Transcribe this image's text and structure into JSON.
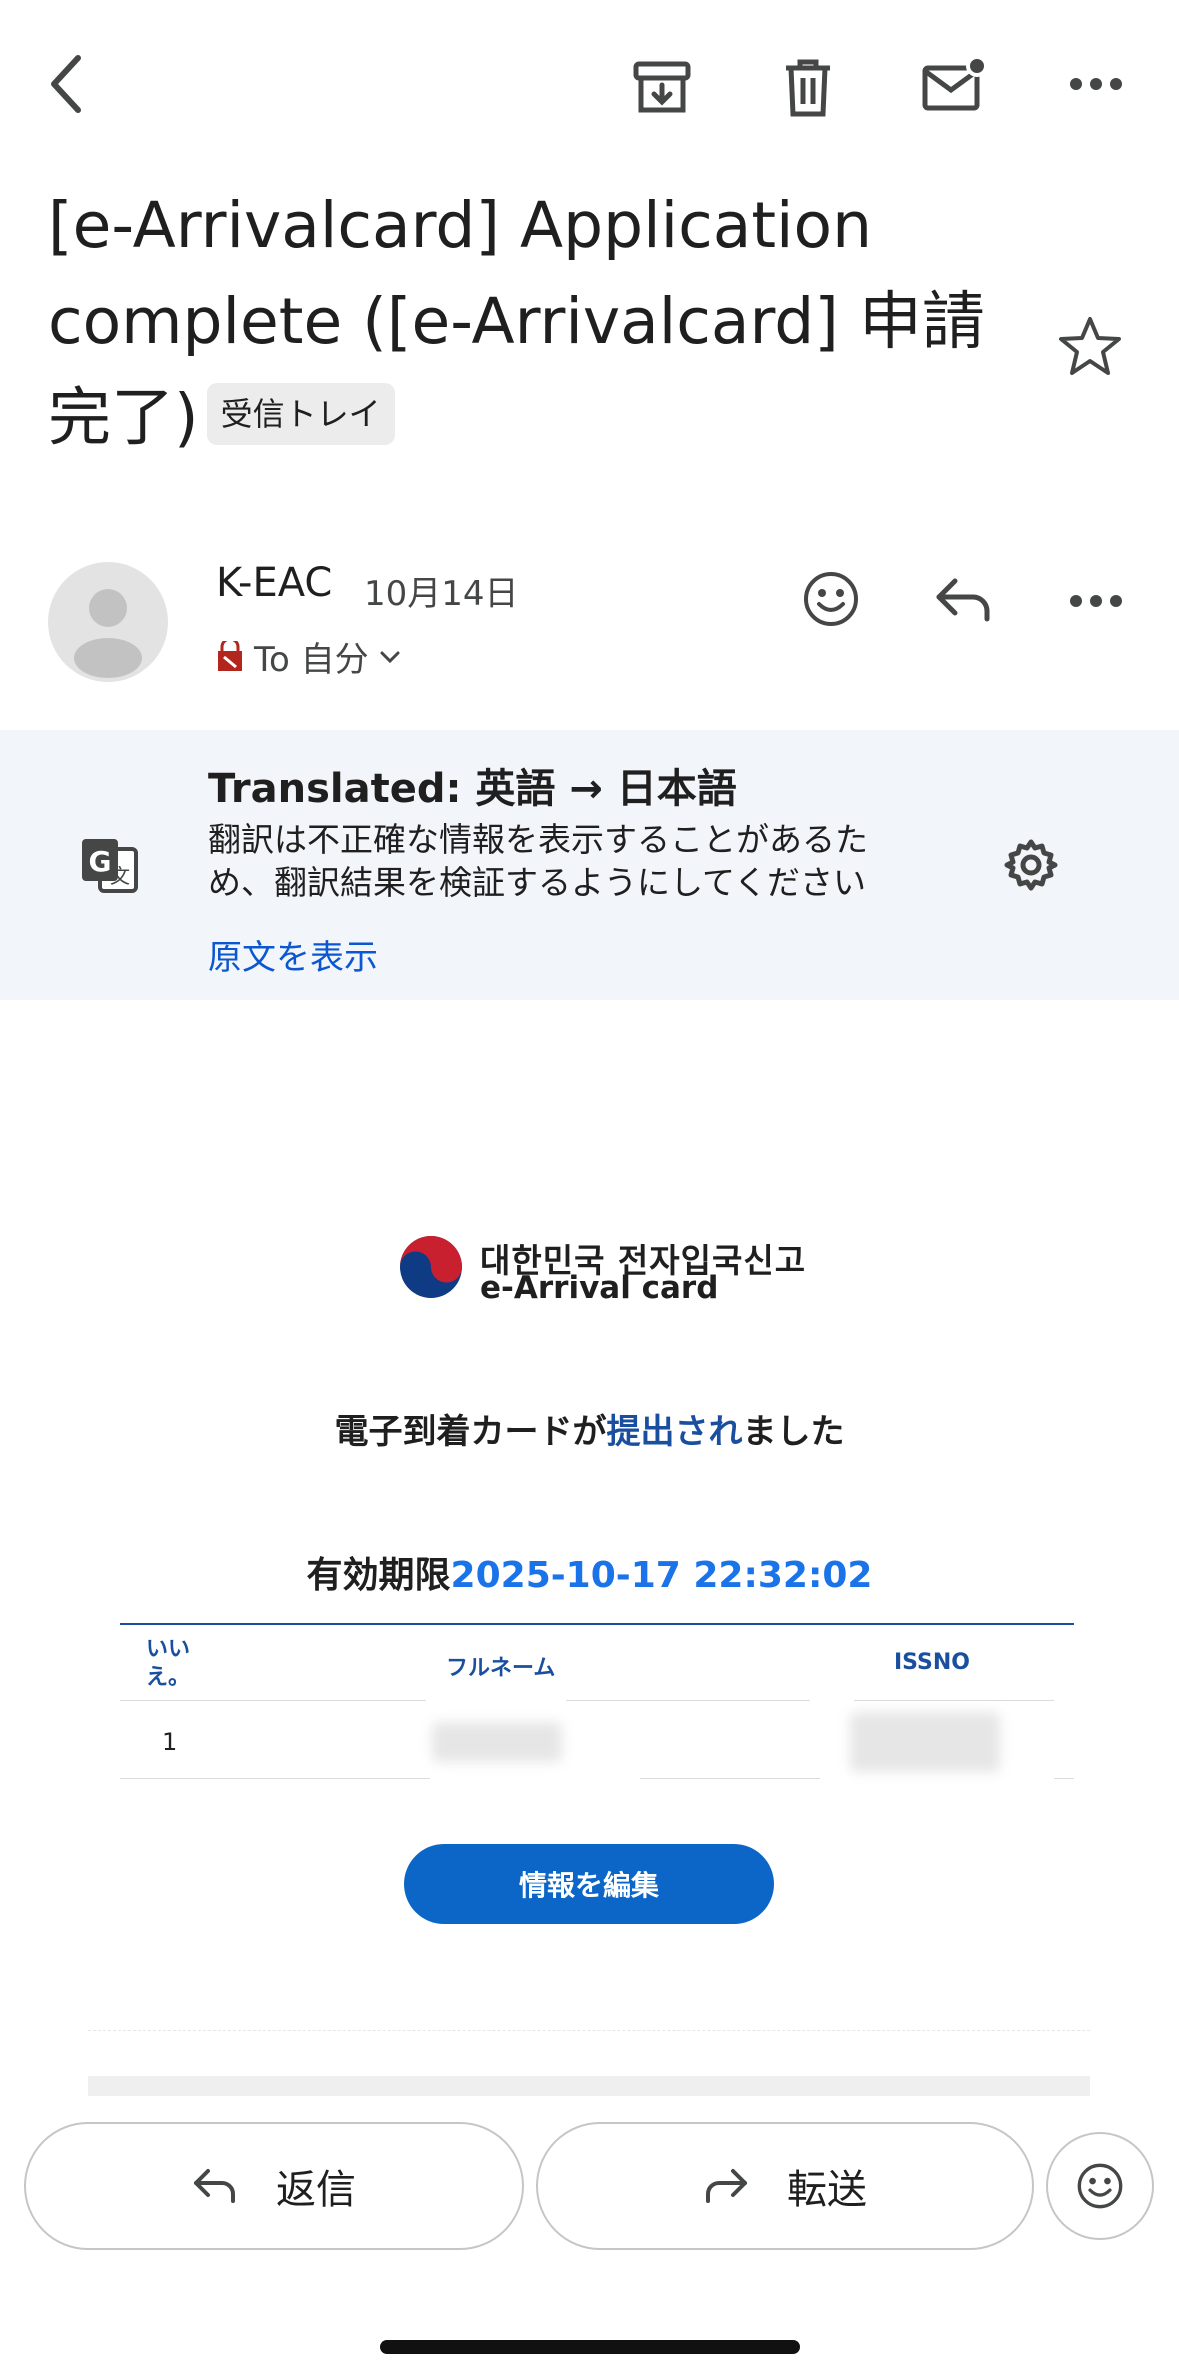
{
  "toolbar": {
    "back_icon": "back-arrow-icon",
    "archive_icon": "archive-icon",
    "delete_icon": "trash-icon",
    "mark_unread_icon": "mail-unread-icon",
    "more_icon": "more-horizontal-icon"
  },
  "subject": {
    "text": "[e-Arrivalcard] Application complete ([e-Arrivalcard] 申請完了)",
    "label": "受信トレイ"
  },
  "sender": {
    "name": "K-EAC",
    "date": "10月14日",
    "to": "To 自分"
  },
  "translation": {
    "title": "Translated: 英語 → 日本語",
    "body": "翻訳は不正確な情報を表示することがあるため、翻訳結果を検証するようにしてください",
    "show_original": "原文を表示"
  },
  "email": {
    "logo_ko": "대한민국 전자입국신고",
    "logo_en": "e-Arrival card",
    "submitted_pre": "電子到着カードが",
    "submitted_hl": "提出され",
    "submitted_post": "ました",
    "expiry_label": "有効期限",
    "expiry_value": "2025-10-17 22:32:02",
    "table": {
      "headers": [
        "いいえ。",
        "フルネーム",
        "ISSNO"
      ],
      "rows": [
        [
          "1",
          "",
          ""
        ]
      ]
    },
    "edit_button": "情報を編集"
  },
  "bottom": {
    "reply": "返信",
    "forward": "転送"
  }
}
